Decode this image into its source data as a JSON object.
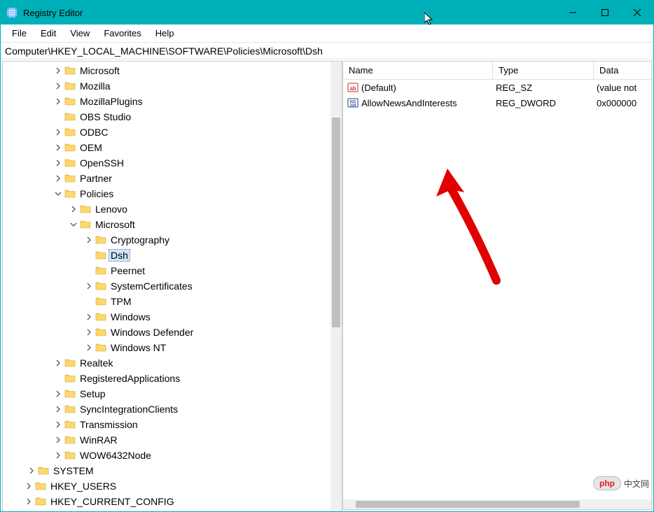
{
  "window": {
    "title": "Registry Editor"
  },
  "menu": {
    "file": "File",
    "edit": "Edit",
    "view": "View",
    "favorites": "Favorites",
    "help": "Help"
  },
  "path": "Computer\\HKEY_LOCAL_MACHINE\\SOFTWARE\\Policies\\Microsoft\\Dsh",
  "columns": {
    "name": "Name",
    "type": "Type",
    "data": "Data"
  },
  "values": [
    {
      "name": "(Default)",
      "type": "REG_SZ",
      "data": "(value not",
      "icon": "string"
    },
    {
      "name": "AllowNewsAndInterests",
      "type": "REG_DWORD",
      "data": "0x000000",
      "icon": "binary"
    }
  ],
  "tree": [
    {
      "label": "Microsoft",
      "level": 0,
      "exp": "closed"
    },
    {
      "label": "Mozilla",
      "level": 0,
      "exp": "closed"
    },
    {
      "label": "MozillaPlugins",
      "level": 0,
      "exp": "closed"
    },
    {
      "label": "OBS Studio",
      "level": 0,
      "exp": "none"
    },
    {
      "label": "ODBC",
      "level": 0,
      "exp": "closed"
    },
    {
      "label": "OEM",
      "level": 0,
      "exp": "closed"
    },
    {
      "label": "OpenSSH",
      "level": 0,
      "exp": "closed"
    },
    {
      "label": "Partner",
      "level": 0,
      "exp": "closed"
    },
    {
      "label": "Policies",
      "level": 0,
      "exp": "open"
    },
    {
      "label": "Lenovo",
      "level": 1,
      "exp": "closed"
    },
    {
      "label": "Microsoft",
      "level": 1,
      "exp": "open"
    },
    {
      "label": "Cryptography",
      "level": 2,
      "exp": "closed"
    },
    {
      "label": "Dsh",
      "level": 2,
      "exp": "none",
      "selected": true
    },
    {
      "label": "Peernet",
      "level": 2,
      "exp": "none"
    },
    {
      "label": "SystemCertificates",
      "level": 2,
      "exp": "closed"
    },
    {
      "label": "TPM",
      "level": 2,
      "exp": "none"
    },
    {
      "label": "Windows",
      "level": 2,
      "exp": "closed"
    },
    {
      "label": "Windows Defender",
      "level": 2,
      "exp": "closed"
    },
    {
      "label": "Windows NT",
      "level": 2,
      "exp": "closed"
    },
    {
      "label": "Realtek",
      "level": 0,
      "exp": "closed"
    },
    {
      "label": "RegisteredApplications",
      "level": 0,
      "exp": "none"
    },
    {
      "label": "Setup",
      "level": 0,
      "exp": "closed"
    },
    {
      "label": "SyncIntegrationClients",
      "level": 0,
      "exp": "closed"
    },
    {
      "label": "Transmission",
      "level": 0,
      "exp": "closed"
    },
    {
      "label": "WinRAR",
      "level": 0,
      "exp": "closed"
    },
    {
      "label": "WOW6432Node",
      "level": 0,
      "exp": "closed"
    },
    {
      "label": "SYSTEM",
      "level": 3,
      "exp": "closed"
    },
    {
      "label": "HKEY_USERS",
      "level": 4,
      "exp": "closed"
    },
    {
      "label": "HKEY_CURRENT_CONFIG",
      "level": 4,
      "exp": "closed"
    }
  ],
  "watermark": {
    "badge": "php",
    "text": "中文网"
  }
}
